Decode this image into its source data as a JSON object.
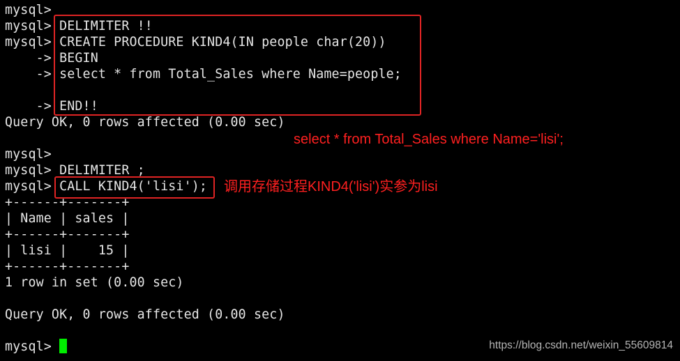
{
  "terminal": {
    "lines": [
      {
        "prompt": "mysql>",
        "text": ""
      },
      {
        "prompt": "mysql>",
        "text": " DELIMITER !!"
      },
      {
        "prompt": "mysql>",
        "text": " CREATE PROCEDURE KIND4(IN people char(20))"
      },
      {
        "prompt": "    ->",
        "text": " BEGIN"
      },
      {
        "prompt": "    ->",
        "text": " select * from Total_Sales where Name=people;"
      },
      {
        "prompt": "",
        "text": ""
      },
      {
        "prompt": "    ->",
        "text": " END!!"
      },
      {
        "prompt": "",
        "text": "Query OK, 0 rows affected (0.00 sec)"
      },
      {
        "prompt": "",
        "text": ""
      },
      {
        "prompt": "mysql>",
        "text": ""
      },
      {
        "prompt": "mysql>",
        "text": " DELIMITER ;"
      },
      {
        "prompt": "mysql>",
        "text": " CALL KIND4('lisi');"
      },
      {
        "prompt": "",
        "text": "+------+-------+"
      },
      {
        "prompt": "",
        "text": "| Name | sales |"
      },
      {
        "prompt": "",
        "text": "+------+-------+"
      },
      {
        "prompt": "",
        "text": "| lisi |    15 |"
      },
      {
        "prompt": "",
        "text": "+------+-------+"
      },
      {
        "prompt": "",
        "text": "1 row in set (0.00 sec)"
      },
      {
        "prompt": "",
        "text": ""
      },
      {
        "prompt": "",
        "text": "Query OK, 0 rows affected (0.00 sec)"
      },
      {
        "prompt": "",
        "text": ""
      },
      {
        "prompt": "mysql>",
        "text": " "
      }
    ],
    "result_table": {
      "columns": [
        "Name",
        "sales"
      ],
      "rows": [
        [
          "lisi",
          "15"
        ]
      ]
    },
    "cursor_color": "#00ee00"
  },
  "annotations": {
    "box_color": "#e02424",
    "note_color": "#ff2020",
    "equivalent_query": "select * from Total_Sales where Name='lisi';",
    "call_note": "调用存储过程KIND4('lisi')实参为lisi"
  },
  "watermark": "https://blog.csdn.net/weixin_55609814"
}
